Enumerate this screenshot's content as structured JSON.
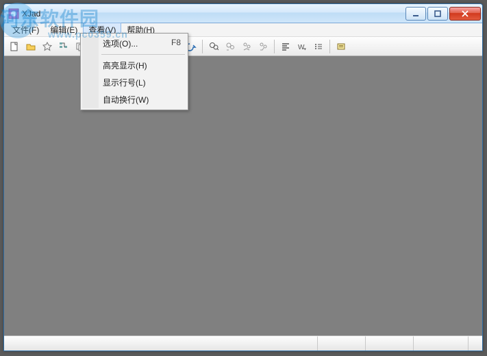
{
  "title": "XJad",
  "menu": {
    "file": "文件(F)",
    "edit": "编辑(E)",
    "view": "查看(V)",
    "help": "帮助(H)"
  },
  "dropdown": {
    "options": "选项(O)...",
    "options_shortcut": "F8",
    "highlight": "高亮显示(H)",
    "linenum": "显示行号(L)",
    "wordwrap": "自动换行(W)"
  },
  "toolbar_icons": [
    "new-file-icon",
    "open-file-icon",
    "favorite-icon",
    "tree-icon",
    "copy1-icon",
    "copy2-icon",
    "cut-icon",
    "copy-icon",
    "paste-icon",
    "undo-icon",
    "redo-icon",
    "find-icon",
    "find-next-icon",
    "bookmark-icon",
    "bookmark-next-icon",
    "align-left-icon",
    "wrap-icon",
    "list-icon",
    "settings-icon"
  ],
  "watermark": {
    "text": "河东软件园",
    "url": "www.pc0359.cn"
  }
}
